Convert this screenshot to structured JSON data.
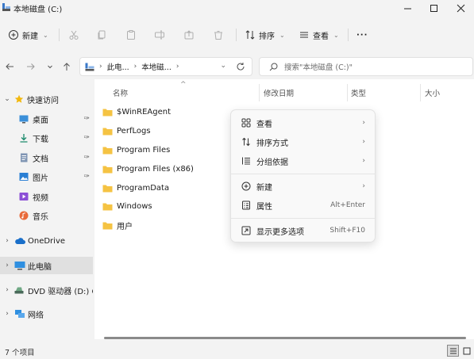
{
  "window": {
    "title": "本地磁盘 (C:)"
  },
  "toolbar": {
    "new_label": "新建",
    "sort_label": "排序",
    "view_label": "查看",
    "more_label": "···"
  },
  "address": {
    "crumbs": [
      "此电...",
      "本地磁...",
      ""
    ],
    "search_placeholder": "搜索\"本地磁盘 (C:)\""
  },
  "sidebar": {
    "items": [
      {
        "label": "快速访问",
        "icon": "star-icon"
      },
      {
        "label": "桌面",
        "icon": "desktop-icon"
      },
      {
        "label": "下载",
        "icon": "download-icon"
      },
      {
        "label": "文档",
        "icon": "document-icon"
      },
      {
        "label": "图片",
        "icon": "picture-icon"
      },
      {
        "label": "视频",
        "icon": "video-icon"
      },
      {
        "label": "音乐",
        "icon": "music-icon"
      },
      {
        "label": "OneDrive",
        "icon": "cloud-icon"
      },
      {
        "label": "此电脑",
        "icon": "computer-icon"
      },
      {
        "label": "DVD 驱动器 (D:) CP",
        "icon": "dvd-icon"
      },
      {
        "label": "网络",
        "icon": "network-icon"
      }
    ]
  },
  "columns": {
    "name": "名称",
    "modified": "修改日期",
    "type": "类型",
    "size": "大小"
  },
  "files": [
    {
      "name": "$WinREAgent"
    },
    {
      "name": "PerfLogs"
    },
    {
      "name": "Program Files"
    },
    {
      "name": "Program Files (x86)"
    },
    {
      "name": "ProgramData"
    },
    {
      "name": "Windows"
    },
    {
      "name": "用户"
    }
  ],
  "context_menu": {
    "items": [
      {
        "label": "查看",
        "icon": "grid-icon",
        "right": "›"
      },
      {
        "label": "排序方式",
        "icon": "sort-icon",
        "right": "›"
      },
      {
        "label": "分组依据",
        "icon": "group-icon",
        "right": "›"
      },
      {
        "label": "新建",
        "icon": "plus-circle-icon",
        "right": "›"
      },
      {
        "label": "属性",
        "icon": "properties-icon",
        "right": "Alt+Enter"
      },
      {
        "label": "显示更多选项",
        "icon": "more-options-icon",
        "right": "Shift+F10"
      }
    ]
  },
  "status": {
    "count": "7 个项目"
  },
  "colors": {
    "folder": "#f5c343",
    "accent": "#0067c0",
    "selected_bg": "#e0e0e0"
  }
}
